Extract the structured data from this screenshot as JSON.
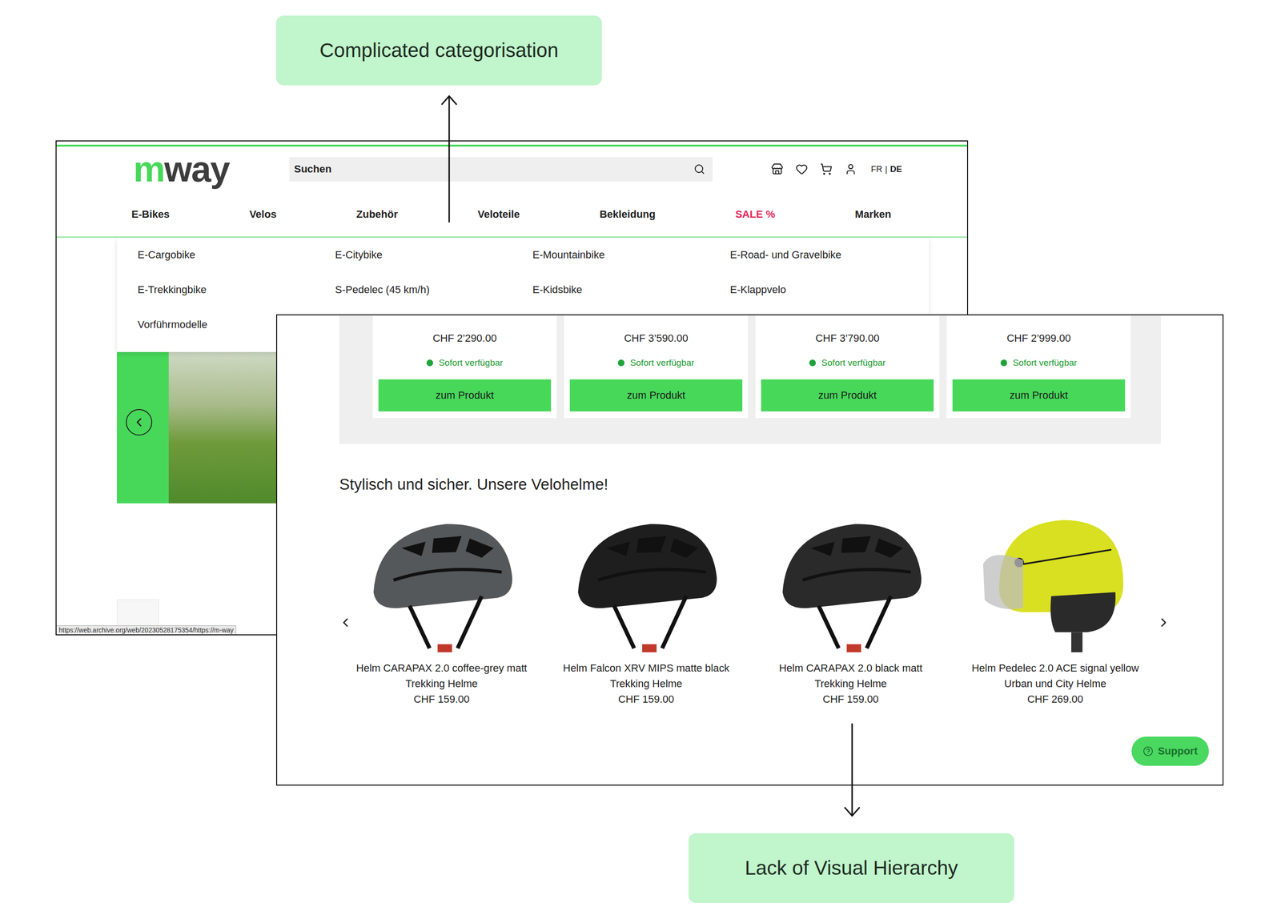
{
  "annotations": [
    {
      "label": "Complicated categorisation"
    },
    {
      "label": "Lack of Visual Hierarchy"
    }
  ],
  "header": {
    "logo_primary": "m",
    "logo_secondary": "way",
    "search_placeholder": "Suchen",
    "languages": [
      {
        "label": "FR",
        "selected": false
      },
      {
        "label": "DE",
        "selected": true
      }
    ],
    "language_separator": "|"
  },
  "nav": [
    {
      "label": "E-Bikes",
      "kind": "normal",
      "expanded": true
    },
    {
      "label": "Velos",
      "kind": "normal",
      "expanded": false
    },
    {
      "label": "Zubehör",
      "kind": "normal",
      "expanded": false
    },
    {
      "label": "Veloteile",
      "kind": "normal",
      "expanded": false
    },
    {
      "label": "Bekleidung",
      "kind": "normal",
      "expanded": false
    },
    {
      "label": "SALE %",
      "kind": "sale",
      "expanded": false
    },
    {
      "label": "Marken",
      "kind": "normal",
      "expanded": false
    }
  ],
  "dropdown": [
    "E-Cargobike",
    "E-Citybike",
    "E-Mountainbike",
    "E-Road- und Gravelbike",
    "E-Trekkingbike",
    "S-Pedelec (45 km/h)",
    "E-Kidsbike",
    "E-Klappvelo",
    "Vorführmodelle"
  ],
  "status_url": "https://web.archive.org/web/20230528175354/https://m-way",
  "products": [
    {
      "price": "CHF 2’290.00",
      "availability": "Sofort verfügbar",
      "available": true,
      "button": "zum Produkt"
    },
    {
      "price": "CHF 3’590.00",
      "availability": "Sofort verfügbar",
      "available": true,
      "button": "zum Produkt"
    },
    {
      "price": "CHF 3’790.00",
      "availability": "Sofort verfügbar",
      "available": true,
      "button": "zum Produkt"
    },
    {
      "price": "CHF 2’999.00",
      "availability": "Sofort verfügbar",
      "available": true,
      "button": "zum Produkt"
    }
  ],
  "helmets": {
    "title": "Stylisch und sicher. Unsere Velohelme!",
    "items": [
      {
        "name": "Helm CARAPAX 2.0 coffee-grey matt",
        "category": "Trekking Helme",
        "price": "CHF 159.00",
        "color": "#55585a",
        "kind": "vented"
      },
      {
        "name": "Helm Falcon XRV MIPS matte black",
        "category": "Trekking Helme",
        "price": "CHF 159.00",
        "color": "#1e1e1e",
        "kind": "vented"
      },
      {
        "name": "Helm CARAPAX 2.0 black matt",
        "category": "Trekking Helme",
        "price": "CHF 159.00",
        "color": "#2a2a2a",
        "kind": "vented"
      },
      {
        "name": "Helm Pedelec 2.0 ACE signal yellow",
        "category": "Urban und City Helme",
        "price": "CHF 269.00",
        "color": "#d9e021",
        "kind": "visor"
      }
    ]
  },
  "support": {
    "label": "Support"
  }
}
